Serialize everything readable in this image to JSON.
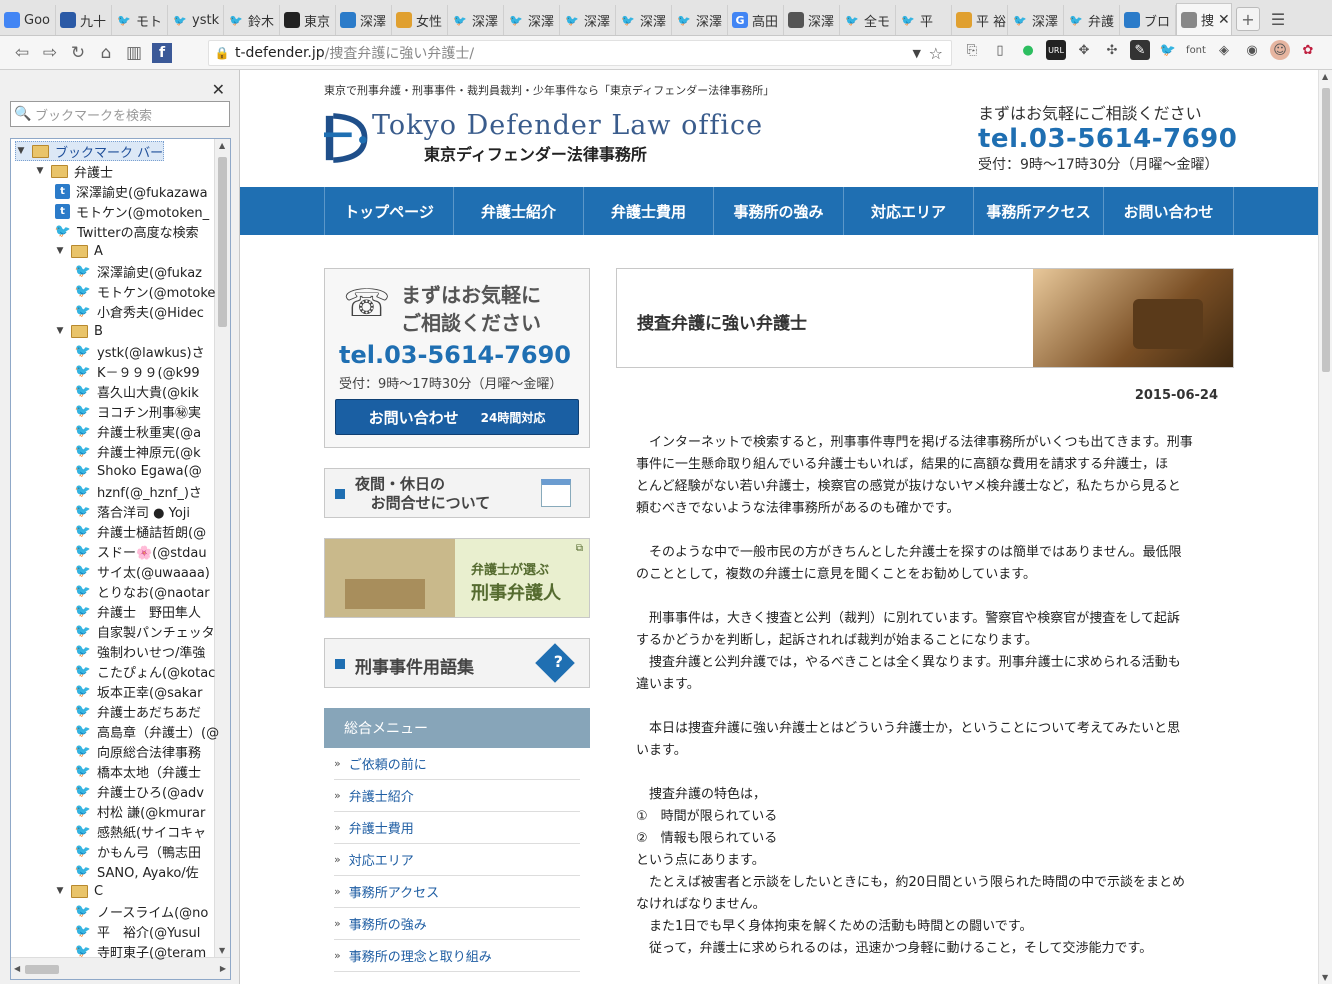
{
  "tabs": [
    {
      "label": "Goo",
      "icon": "google-docs-icon",
      "color": "#4285f4"
    },
    {
      "label": "九十",
      "icon": "bookmark-icon",
      "color": "#2b5aa6"
    },
    {
      "label": "モト",
      "icon": "twitter-icon",
      "color": "#1da1f2"
    },
    {
      "label": "ystk",
      "icon": "twitter-icon",
      "color": "#1da1f2"
    },
    {
      "label": "鈴木",
      "icon": "twitter-icon",
      "color": "#1da1f2"
    },
    {
      "label": "東京",
      "icon": "note-icon",
      "color": "#222222"
    },
    {
      "label": "深澤",
      "icon": "blog-icon",
      "color": "#2b7bc9"
    },
    {
      "label": "女性",
      "icon": "sun-icon",
      "color": "#e0a030"
    },
    {
      "label": "深澤",
      "icon": "twitter-icon",
      "color": "#1da1f2"
    },
    {
      "label": "深澤",
      "icon": "twitter-icon",
      "color": "#1da1f2"
    },
    {
      "label": "深澤",
      "icon": "twitter-icon",
      "color": "#1da1f2"
    },
    {
      "label": "深澤",
      "icon": "twitter-icon",
      "color": "#1da1f2"
    },
    {
      "label": "深澤",
      "icon": "twitter-icon",
      "color": "#1da1f2"
    },
    {
      "label": "高田",
      "icon": "google-icon",
      "color": "#4285f4"
    },
    {
      "label": "深澤",
      "icon": "image-icon",
      "color": "#555555"
    },
    {
      "label": "全モ",
      "icon": "twitter-icon",
      "color": "#1da1f2"
    },
    {
      "label": "平",
      "icon": "twitter-icon",
      "color": "#1da1f2"
    },
    {
      "label": "平 裕",
      "icon": "sun-icon",
      "color": "#e0a030"
    },
    {
      "label": "深澤",
      "icon": "twitter-icon",
      "color": "#1da1f2"
    },
    {
      "label": "弁護",
      "icon": "twitter-icon",
      "color": "#1da1f2"
    },
    {
      "label": "ブロ",
      "icon": "scales-icon",
      "color": "#2b7bc9"
    },
    {
      "label": "捜",
      "icon": "globe-icon",
      "color": "#888888",
      "active": true
    }
  ],
  "url": {
    "host": "t-defender.jp",
    "path": "/捜査弁護に強い弁護士/"
  },
  "extensions": [
    "share-icon",
    "bookmark-icon",
    "evernote-icon",
    "url-icon",
    "move-icon",
    "puzzle-icon",
    "edit-icon",
    "twitter-icon",
    "font-icon",
    "pocket-icon",
    "chat-icon",
    "avatar-icon",
    "settings-icon"
  ],
  "ext_font_label": "font",
  "sidebar": {
    "search_placeholder": "ブックマークを検索",
    "items": [
      {
        "label": "ブックマーク バー",
        "type": "folder",
        "level": 0,
        "arrow": "▼",
        "selected": true
      },
      {
        "label": "弁護士",
        "type": "folder",
        "level": 1,
        "arrow": "▼"
      },
      {
        "label": "深澤諭史(@fukazawa",
        "type": "blog",
        "level": 2
      },
      {
        "label": "モトケン(@motoken_",
        "type": "blog",
        "level": 2
      },
      {
        "label": "Twitterの高度な検索",
        "type": "twitter",
        "level": 2
      },
      {
        "label": "A",
        "type": "folder",
        "level": 2,
        "arrow": "▼"
      },
      {
        "label": "深澤諭史(@fukaz",
        "type": "twitter",
        "level": 3
      },
      {
        "label": "モトケン(@motoke",
        "type": "twitter",
        "level": 3
      },
      {
        "label": "小倉秀夫(@Hidec",
        "type": "twitter",
        "level": 3
      },
      {
        "label": "B",
        "type": "folder",
        "level": 2,
        "arrow": "▼"
      },
      {
        "label": "ystk(@lawkus)さ",
        "type": "twitter",
        "level": 3
      },
      {
        "label": "K－９９９(@k99",
        "type": "twitter",
        "level": 3
      },
      {
        "label": "喜久山大貴(@kik",
        "type": "twitter",
        "level": 3
      },
      {
        "label": "ヨコチン刑事㊙実",
        "type": "twitter",
        "level": 3
      },
      {
        "label": "弁護士秋重実(@a",
        "type": "twitter",
        "level": 3
      },
      {
        "label": "弁護士神原元(@k",
        "type": "twitter",
        "level": 3
      },
      {
        "label": "Shoko Egawa(@",
        "type": "twitter",
        "level": 3
      },
      {
        "label": "hznf(@_hznf_)さ",
        "type": "twitter",
        "level": 3
      },
      {
        "label": "落合洋司 ● Yoji",
        "type": "twitter",
        "level": 3
      },
      {
        "label": "弁護士樋詰哲朗(@",
        "type": "twitter",
        "level": 3
      },
      {
        "label": "スドー🌸(@stdau",
        "type": "twitter",
        "level": 3
      },
      {
        "label": "サイ太(@uwaaaa)",
        "type": "twitter",
        "level": 3
      },
      {
        "label": "とりなお(@naotar",
        "type": "twitter",
        "level": 3
      },
      {
        "label": "弁護士　野田隼人",
        "type": "twitter",
        "level": 3
      },
      {
        "label": "自家製パンチェッタ",
        "type": "twitter",
        "level": 3
      },
      {
        "label": "強制わいせつ/準強",
        "type": "twitter",
        "level": 3
      },
      {
        "label": "こたぴょん(@kotac",
        "type": "twitter",
        "level": 3
      },
      {
        "label": "坂本正幸(@sakar",
        "type": "twitter",
        "level": 3
      },
      {
        "label": "弁護士あだちあだ",
        "type": "twitter",
        "level": 3
      },
      {
        "label": "高島章（弁護士）(@",
        "type": "twitter",
        "level": 3
      },
      {
        "label": "向原総合法律事務",
        "type": "twitter",
        "level": 3
      },
      {
        "label": "橋本太地（弁護士",
        "type": "twitter",
        "level": 3
      },
      {
        "label": "弁護士ひろ(@adv",
        "type": "twitter",
        "level": 3
      },
      {
        "label": "村松 謙(@kmurar",
        "type": "twitter",
        "level": 3
      },
      {
        "label": "感熱紙(サイコキャ",
        "type": "twitter",
        "level": 3
      },
      {
        "label": "かもん弓（鴨志田",
        "type": "twitter",
        "level": 3
      },
      {
        "label": "SANO, Ayako/佐",
        "type": "twitter",
        "level": 3
      },
      {
        "label": "C",
        "type": "folder",
        "level": 2,
        "arrow": "▼"
      },
      {
        "label": "ノースライム(@no",
        "type": "twitter",
        "level": 3
      },
      {
        "label": "平　裕介(@Yusul",
        "type": "twitter",
        "level": 3
      },
      {
        "label": "寺町東子(@teram",
        "type": "twitter",
        "level": 3
      }
    ]
  },
  "site": {
    "tagline": "東京で刑事弁護・刑事事件・裁判員裁判・少年事件なら「東京ディフェンダー法律事務所」",
    "logo_en": "Tokyo Defender Law office",
    "logo_jp": "東京ディフェンダー法律事務所",
    "header_cta": "まずはお気軽にご相談ください",
    "header_tel": "tel.03-5614-7690",
    "header_hours": "受付：9時～17時30分（月曜～金曜）",
    "nav": [
      "トップページ",
      "弁護士紹介",
      "弁護士費用",
      "事務所の強み",
      "対応エリア",
      "事務所アクセス",
      "お問い合わせ"
    ],
    "contact_box": {
      "msg1": "まずはお気軽に",
      "msg2": "ご相談ください",
      "tel": "tel.03-5614-7690",
      "hours": "受付：9時～17時30分（月曜～金曜）",
      "button": "お問い合わせ",
      "button_sub": "24時間対応"
    },
    "banner_night_1": "夜間・休日の",
    "banner_night_2": "お問合せについて",
    "banner_criminal_1": "弁護士が選ぶ",
    "banner_criminal_2": "刑事弁護人",
    "banner_glossary": "刑事事件用語集",
    "menu_title": "総合メニュー",
    "menu": [
      "ご依頼の前に",
      "弁護士紹介",
      "弁護士費用",
      "対応エリア",
      "事務所アクセス",
      "事務所の強み",
      "事務所の理念と取り組み"
    ]
  },
  "article": {
    "title": "捜査弁護に強い弁護士",
    "date": "2015-06-24",
    "paragraphs": [
      [
        "　インターネットで検索すると，刑事事件専門を掲げる法律事務所がいくつも出てきます。刑事",
        "事件に一生懸命取り組んでいる弁護士もいれば，結果的に高額な費用を請求する弁護士，ほ",
        "とんど経験がない若い弁護士，検察官の感覚が抜けないヤメ検弁護士など，私たちから見ると",
        "頼むべきでないような法律事務所があるのも確かです。"
      ],
      [
        "　そのような中で一般市民の方がきちんとした弁護士を探すのは簡単ではありません。最低限",
        "のこととして，複数の弁護士に意見を聞くことをお勧めしています。"
      ],
      [
        "　刑事事件は，大きく捜査と公判（裁判）に別れています。警察官や検察官が捜査をして起訴",
        "するかどうかを判断し，起訴されれば裁判が始まることになります。",
        "　捜査弁護と公判弁護では，やるべきことは全く異なります。刑事弁護士に求められる活動も",
        "違います。"
      ],
      [
        "　本日は捜査弁護に強い弁護士とはどういう弁護士か，ということについて考えてみたいと思",
        "います。"
      ],
      [
        "　捜査弁護の特色は，",
        "①　時間が限られている",
        "②　情報も限られている",
        "という点にあります。",
        "　たとえば被害者と示談をしたいときにも，約20日間という限られた時間の中で示談をまとめ",
        "なければなりません。",
        "　また1日でも早く身体拘束を解くための活動も時間との闘いです。",
        "　従って，弁護士に求められるのは，迅速かつ身軽に動けること，そして交渉能力です。"
      ]
    ]
  }
}
